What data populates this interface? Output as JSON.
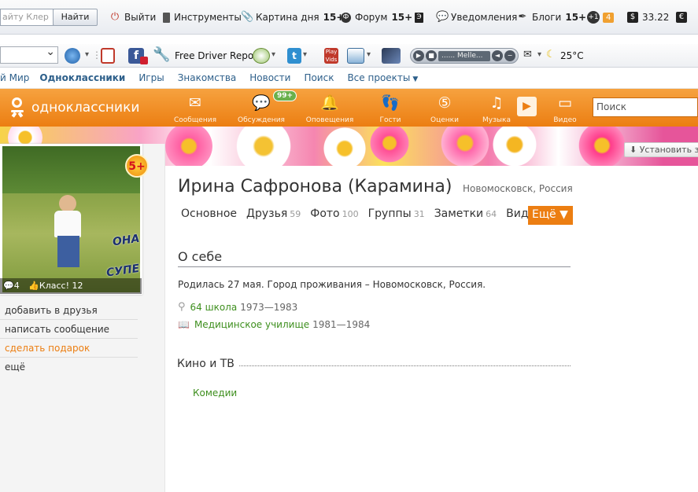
{
  "toolbar1": {
    "search_placeholder": "айту Клер",
    "find_button": "Найти",
    "logout": "Выйти",
    "tools": "Инструменты",
    "picture_of_day": "Картина дня",
    "picture_count": "15+",
    "forum": "Форум",
    "forum_count": "15+",
    "notifications": "Уведомления",
    "blogs": "Блоги",
    "blogs_count": "15+",
    "plus_one": "+1",
    "four_count": "4",
    "dollar_rate": "33.22"
  },
  "toolbar2": {
    "driver_report": "Free Driver Report",
    "player_track": "...... Melle...",
    "weather": "25°C"
  },
  "nav": {
    "items": [
      "й Мир",
      "Одноклассники",
      "Игры",
      "Знакомства",
      "Новости",
      "Поиск",
      "Все проекты"
    ]
  },
  "header": {
    "logo_text": "одноклассники",
    "items": [
      "Сообщения",
      "Обсуждения",
      "Оповещения",
      "Гости",
      "Оценки",
      "Музыка",
      "Видео"
    ],
    "discussions_badge": "99+",
    "search_placeholder": "Поиск",
    "install_button": "Установить з"
  },
  "profile": {
    "name": "Ирина Сафронова (Карамина)",
    "location": "Новомосковск, Россия",
    "age_badge": "5+",
    "photo_stats": "4",
    "photo_class": "Класс! 12",
    "photo_caption_top": "ОНА",
    "photo_caption_bottom": "СУПЕР",
    "actions": [
      "добавить в друзья",
      "написать сообщение",
      "сделать подарок",
      "ещё"
    ]
  },
  "tabs": [
    {
      "label": "Основное",
      "count": ""
    },
    {
      "label": "Друзья",
      "count": "59"
    },
    {
      "label": "Фото",
      "count": "100"
    },
    {
      "label": "Группы",
      "count": "31"
    },
    {
      "label": "Заметки",
      "count": "64"
    },
    {
      "label": "Видео",
      "count": ""
    }
  ],
  "more_button": "Ещё ▼",
  "about": {
    "title": "О себе",
    "text": "Родилась 27 мая. Город проживания – Новомосковск, Россия.",
    "school": "64 школа",
    "school_years": "1973—1983",
    "college": "Медицинское училище",
    "college_years": "1981—1984"
  },
  "kino": {
    "title": "Кино и ТВ",
    "link": "Комедии"
  },
  "colors": {
    "brand_orange": "#ec7e12",
    "link_green": "#3e8f1e",
    "link_blue": "#2d5f8a"
  }
}
